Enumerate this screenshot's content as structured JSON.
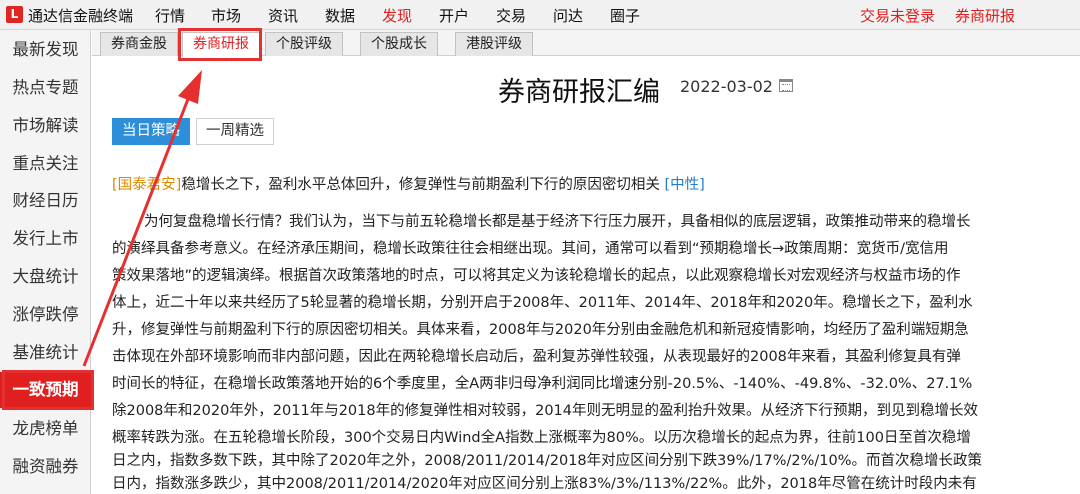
{
  "app": {
    "logo_glyph": "L",
    "title": "通达信金融终端"
  },
  "menu": [
    {
      "label": "行情"
    },
    {
      "label": "市场"
    },
    {
      "label": "资讯"
    },
    {
      "label": "数据"
    },
    {
      "label": "发现",
      "active": true
    },
    {
      "label": "开户"
    },
    {
      "label": "交易"
    },
    {
      "label": "问达"
    },
    {
      "label": "圈子"
    }
  ],
  "topright": {
    "login_status": "交易未登录",
    "current": "券商研报"
  },
  "sidebar": [
    {
      "label": "最新发现"
    },
    {
      "label": "热点专题"
    },
    {
      "label": "市场解读"
    },
    {
      "label": "重点关注"
    },
    {
      "label": "财经日历"
    },
    {
      "label": "发行上市"
    },
    {
      "label": "大盘统计"
    },
    {
      "label": "涨停跌停"
    },
    {
      "label": "基准统计"
    },
    {
      "label": "一致预期",
      "active": true
    },
    {
      "label": "龙虎榜单"
    },
    {
      "label": "融资融券"
    }
  ],
  "tabs": [
    {
      "label": "券商金股"
    },
    {
      "label": "券商研报",
      "active": true
    },
    {
      "label": "个股评级"
    },
    {
      "label": "个股成长"
    },
    {
      "label": "港股评级"
    }
  ],
  "page": {
    "title": "券商研报汇编",
    "date": "2022-03-02"
  },
  "filters": {
    "today": "当日策略",
    "week": "一周精选"
  },
  "report": {
    "broker": "[国泰君安]",
    "title": "稳增长之下，盈利水平总体回升，修复弹性与前期盈利下行的原因密切相关",
    "rating": "[中性]",
    "lines": [
      "为何复盘稳增长行情？我们认为，当下与前五轮稳增长都是基于经济下行压力展开，具备相似的底层逻辑，政策推动带来的稳增长",
      "的演绎具备参考意义。在经济承压期间，稳增长政策往往会相继出现。其间，通常可以看到“预期稳增长→政策周期：宽货币/宽信用",
      "策效果落地”的逻辑演绎。根据首次政策落地的时点，可以将其定义为该轮稳增长的起点，以此观察稳增长对宏观经济与权益市场的作",
      "体上，近二十年以来共经历了5轮显著的稳增长期，分别开启于2008年、2011年、2014年、2018年和2020年。稳增长之下，盈利水",
      "升，修复弹性与前期盈利下行的原因密切相关。具体来看，2008年与2020年分别由金融危机和新冠疫情影响，均经历了盈利端短期急",
      "击体现在外部环境影响而非内部问题，因此在两轮稳增长启动后，盈利复苏弹性较强，从表现最好的2008年来看，其盈利修复具有弹",
      "时间长的特征，在稳增长政策落地开始的6个季度里，全A两非归母净利润同比增速分别-20.5%、-140%、-49.8%、-32.0%、27.1%",
      "除2008年和2020年外，2011年与2018年的修复弹性相对较弱，2014年则无明显的盈利抬升效果。从经济下行预期，到见到稳增长效",
      "概率转跌为涨。在五轮稳增长阶段，300个交易日内Wind全A指数上涨概率为80%。以历次稳增长的起点为界，往前100日至首次稳增",
      "日之内，指数多数下跌，其中除了2020年之外，2008/2011/2014/2018年对应区间分别下跌39%/17%/2%/10%。而首次稳增长政策",
      "日内，指数涨多跌少，其中2008/2011/2014/2020年对应区间分别上涨83%/3%/113%/22%。此外，2018年尽管在统计时段内未有"
    ]
  }
}
